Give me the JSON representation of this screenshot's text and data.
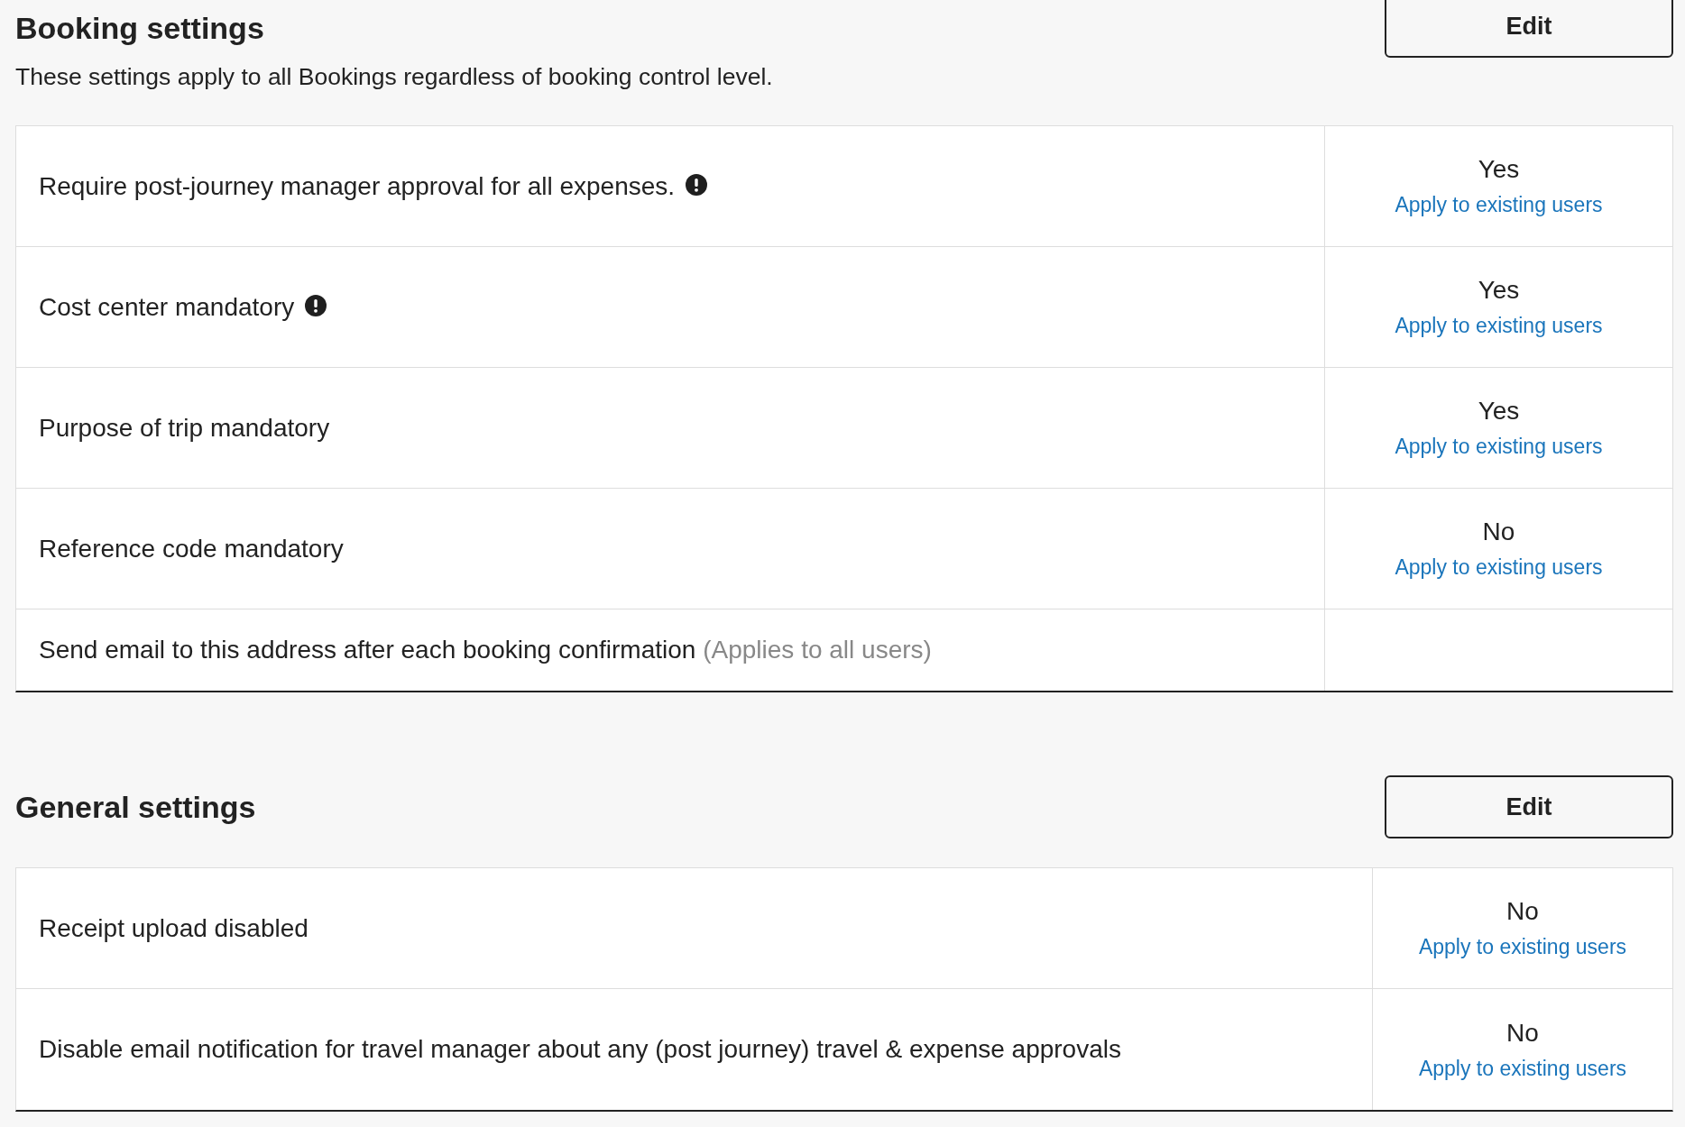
{
  "sections": [
    {
      "title": "Booking settings",
      "description": "These settings apply to all Bookings regardless of booking control level.",
      "edit_button": "Edit",
      "rows": [
        {
          "label": "Require post-journey manager approval for all expenses.",
          "info": true,
          "value": "Yes",
          "link": "Apply to existing users"
        },
        {
          "label": "Cost center mandatory",
          "info": true,
          "value": "Yes",
          "link": "Apply to existing users"
        },
        {
          "label": "Purpose of trip mandatory",
          "info": false,
          "value": "Yes",
          "link": "Apply to existing users"
        },
        {
          "label": "Reference code mandatory",
          "info": false,
          "value": "No",
          "link": "Apply to existing users"
        },
        {
          "label": "Send email to this address after each booking confirmation",
          "note": "(Applies to all users)",
          "info": false
        }
      ]
    },
    {
      "title": "General settings",
      "edit_button": "Edit",
      "rows": [
        {
          "label": "Receipt upload disabled",
          "info": false,
          "value": "No",
          "link": "Apply to existing users"
        },
        {
          "label": "Disable email notification for travel manager about any (post journey) travel & expense approvals",
          "info": false,
          "value": "No",
          "link": "Apply to existing users"
        }
      ]
    }
  ]
}
